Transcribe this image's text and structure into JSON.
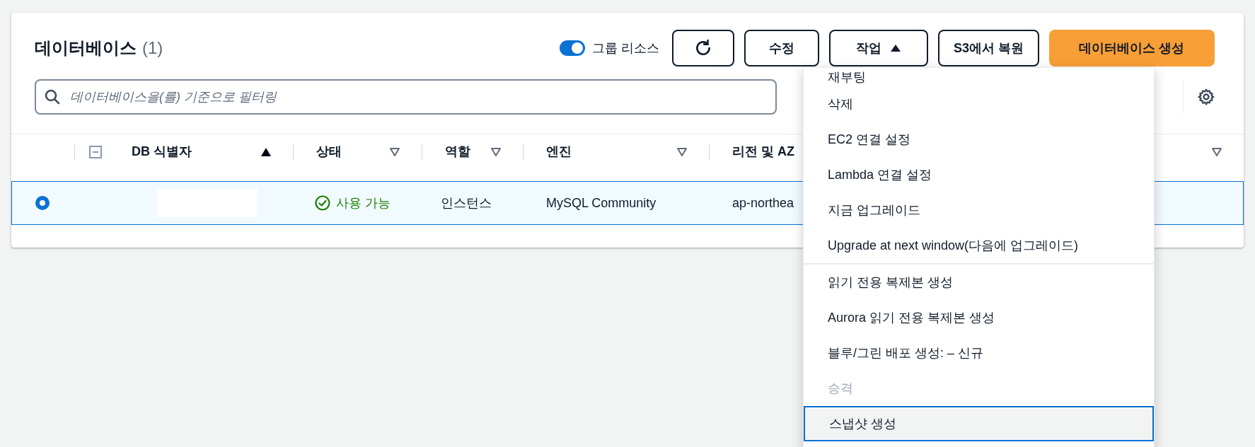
{
  "header": {
    "title": "데이터베이스",
    "count": "(1)"
  },
  "group_toggle": {
    "label": "그룹 리소스",
    "on": true
  },
  "buttons": [
    {
      "kind": "icon"
    },
    {
      "kind": "normal",
      "label": "수정"
    },
    {
      "kind": "menu",
      "label": "작업",
      "expanded": true
    },
    {
      "kind": "normal",
      "label": "S3에서 복원"
    },
    {
      "kind": "primary",
      "label": "데이터베이스 생성"
    }
  ],
  "search": {
    "placeholder": "데이터베이스을(를) 기준으로 필터링"
  },
  "table": {
    "columns": [
      {
        "label": "DB 식별자",
        "sorted": true
      },
      {
        "label": "상태",
        "sorted": false
      },
      {
        "label": "역할",
        "sorted": false
      },
      {
        "label": "엔진",
        "sorted": false
      },
      {
        "label": "리전 및 AZ",
        "sorted": false
      }
    ],
    "rows": [
      {
        "selected": true,
        "status": "사용 가능",
        "role": "인스턴스",
        "engine": "MySQL Community",
        "region": "ap-northea"
      }
    ]
  },
  "actions_menu": [
    {
      "label": "재부팅",
      "disabled": false,
      "focused": false,
      "divider_after": false
    },
    {
      "label": "삭제",
      "disabled": false,
      "focused": false,
      "divider_after": false
    },
    {
      "label": "EC2 연결 설정",
      "disabled": false,
      "focused": false,
      "divider_after": false
    },
    {
      "label": "Lambda 연결 설정",
      "disabled": false,
      "focused": false,
      "divider_after": false
    },
    {
      "label": "지금 업그레이드",
      "disabled": false,
      "focused": false,
      "divider_after": false
    },
    {
      "label": "Upgrade at next window(다음에 업그레이드)",
      "disabled": false,
      "focused": false,
      "divider_after": true
    },
    {
      "label": "읽기 전용 복제본 생성",
      "disabled": false,
      "focused": false,
      "divider_after": false
    },
    {
      "label": "Aurora 읽기 전용 복제본 생성",
      "disabled": false,
      "focused": false,
      "divider_after": false
    },
    {
      "label": "블루/그린 배포 생성: – 신규",
      "disabled": false,
      "focused": false,
      "divider_after": false
    },
    {
      "label": "승격",
      "disabled": true,
      "focused": false,
      "divider_after": false
    },
    {
      "label": "스냅샷 생성",
      "disabled": false,
      "focused": true,
      "divider_after": false
    }
  ]
}
